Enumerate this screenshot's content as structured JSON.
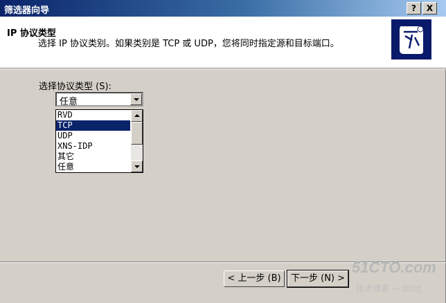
{
  "window": {
    "title": "筛选器向导",
    "help_btn": "?",
    "close_btn": "X"
  },
  "header": {
    "title": "IP 协议类型",
    "description": "选择 IP 协议类别。如果类别是 TCP 或 UDP，您将同时指定源和目标端口。"
  },
  "form": {
    "label": "选择协议类型 (S):",
    "combo_value": "任意",
    "list_items": [
      "RVD",
      "TCP",
      "UDP",
      "XNS-IDP",
      "其它",
      "任意"
    ],
    "selected_index": 1
  },
  "buttons": {
    "back": "< 上一步 (B)",
    "next": "下一步 (N) >"
  },
  "watermark": {
    "brand": "51CTO.com",
    "sub": "技术博客 — Blog"
  }
}
